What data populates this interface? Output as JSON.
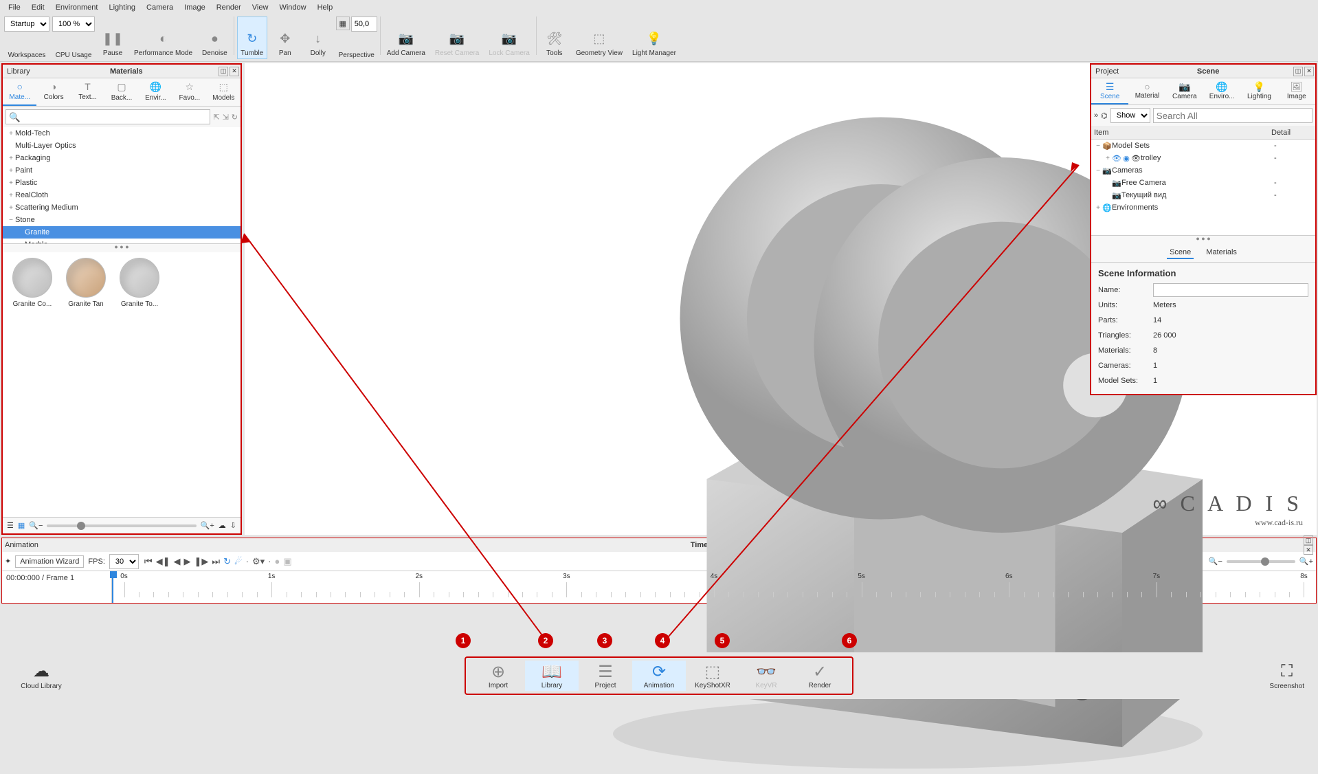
{
  "menu": [
    "File",
    "Edit",
    "Environment",
    "Lighting",
    "Camera",
    "Image",
    "Render",
    "View",
    "Window",
    "Help"
  ],
  "toolbar": {
    "workspaces": {
      "options": [
        "Startup"
      ],
      "label": "Workspaces"
    },
    "cpu": {
      "options": [
        "100 %"
      ],
      "label": "CPU Usage"
    },
    "pause": "Pause",
    "perf": "Performance\nMode",
    "denoise": "Denoise",
    "tumble": "Tumble",
    "pan": "Pan",
    "dolly": "Dolly",
    "perspective": "Perspective",
    "persp_val": "50,0",
    "addcam": "Add\nCamera",
    "resetcam": "Reset\nCamera",
    "lockcam": "Lock\nCamera",
    "tools": "Tools",
    "geom": "Geometry\nView",
    "light": "Light\nManager"
  },
  "library": {
    "title": "Library",
    "subtitle": "Materials",
    "tabs": [
      "Mate...",
      "Colors",
      "Text...",
      "Back...",
      "Envir...",
      "Favo...",
      "Models"
    ],
    "tree": [
      {
        "label": "Mold-Tech",
        "tw": "+",
        "lvl": 0
      },
      {
        "label": "Multi-Layer Optics",
        "tw": "",
        "lvl": 0
      },
      {
        "label": "Packaging",
        "tw": "+",
        "lvl": 0
      },
      {
        "label": "Paint",
        "tw": "+",
        "lvl": 0
      },
      {
        "label": "Plastic",
        "tw": "+",
        "lvl": 0
      },
      {
        "label": "RealCloth",
        "tw": "+",
        "lvl": 0
      },
      {
        "label": "Scattering Medium",
        "tw": "+",
        "lvl": 0
      },
      {
        "label": "Stone",
        "tw": "−",
        "lvl": 0
      },
      {
        "label": "Granite",
        "tw": "",
        "lvl": 1,
        "selected": true
      },
      {
        "label": "Marble",
        "tw": "",
        "lvl": 1
      }
    ],
    "thumbs": [
      "Granite Co...",
      "Granite Tan",
      "Granite To..."
    ]
  },
  "scene": {
    "title": "Project",
    "subtitle": "Scene",
    "tabs": [
      "Scene",
      "Material",
      "Camera",
      "Enviro...",
      "Lighting",
      "Image"
    ],
    "show": "Show",
    "search_ph": "Search All",
    "cols": {
      "item": "Item",
      "detail": "Detail"
    },
    "tree": [
      {
        "tw": "−",
        "ic": "📦",
        "lab": "Model Sets",
        "det": "-",
        "lvl": 0
      },
      {
        "tw": "+",
        "ic": "👁",
        "lab": "trolley",
        "det": "-",
        "lvl": 1,
        "extra": "🔵"
      },
      {
        "tw": "−",
        "ic": "📷",
        "lab": "Cameras",
        "det": "",
        "lvl": 0
      },
      {
        "tw": "",
        "ic": "📷",
        "lab": "Free Camera",
        "det": "-",
        "lvl": 1,
        "blue": true
      },
      {
        "tw": "",
        "ic": "📷",
        "lab": "Текущий вид",
        "det": "-",
        "lvl": 1,
        "blue": true
      },
      {
        "tw": "+",
        "ic": "🌐",
        "lab": "Environments",
        "det": "",
        "lvl": 0
      }
    ],
    "subtabs": [
      "Scene",
      "Materials"
    ],
    "info_title": "Scene Information",
    "info": [
      {
        "k": "Name:",
        "v": "",
        "input": true
      },
      {
        "k": "Units:",
        "v": "Meters"
      },
      {
        "k": "Parts:",
        "v": "14"
      },
      {
        "k": "Triangles:",
        "v": "26 000"
      },
      {
        "k": "Materials:",
        "v": "8"
      },
      {
        "k": "Cameras:",
        "v": "1"
      },
      {
        "k": "Model Sets:",
        "v": "1"
      }
    ]
  },
  "animation": {
    "title": "Animation",
    "subtitle": "Timeline",
    "wizard": "Animation Wizard",
    "fps_label": "FPS:",
    "fps": "30",
    "time": "00:00:000 / Frame 1",
    "ticks": [
      "0s",
      "1s",
      "2s",
      "3s",
      "4s",
      "5s",
      "6s",
      "7s",
      "8s"
    ]
  },
  "bottom": {
    "cloud": "Cloud Library",
    "screenshot": "Screenshot",
    "btns": [
      {
        "label": "Import",
        "active": false
      },
      {
        "label": "Library",
        "active": true
      },
      {
        "label": "Project",
        "active": false
      },
      {
        "label": "Animation",
        "active": true
      },
      {
        "label": "KeyShotXR",
        "active": false
      },
      {
        "label": "KeyVR",
        "active": false,
        "disabled": true
      },
      {
        "label": "Render",
        "active": false
      }
    ]
  },
  "watermark": {
    "brand": "C A D I S",
    "url": "www.cad-is.ru"
  },
  "callouts": [
    "1",
    "2",
    "3",
    "4",
    "5",
    "6"
  ]
}
